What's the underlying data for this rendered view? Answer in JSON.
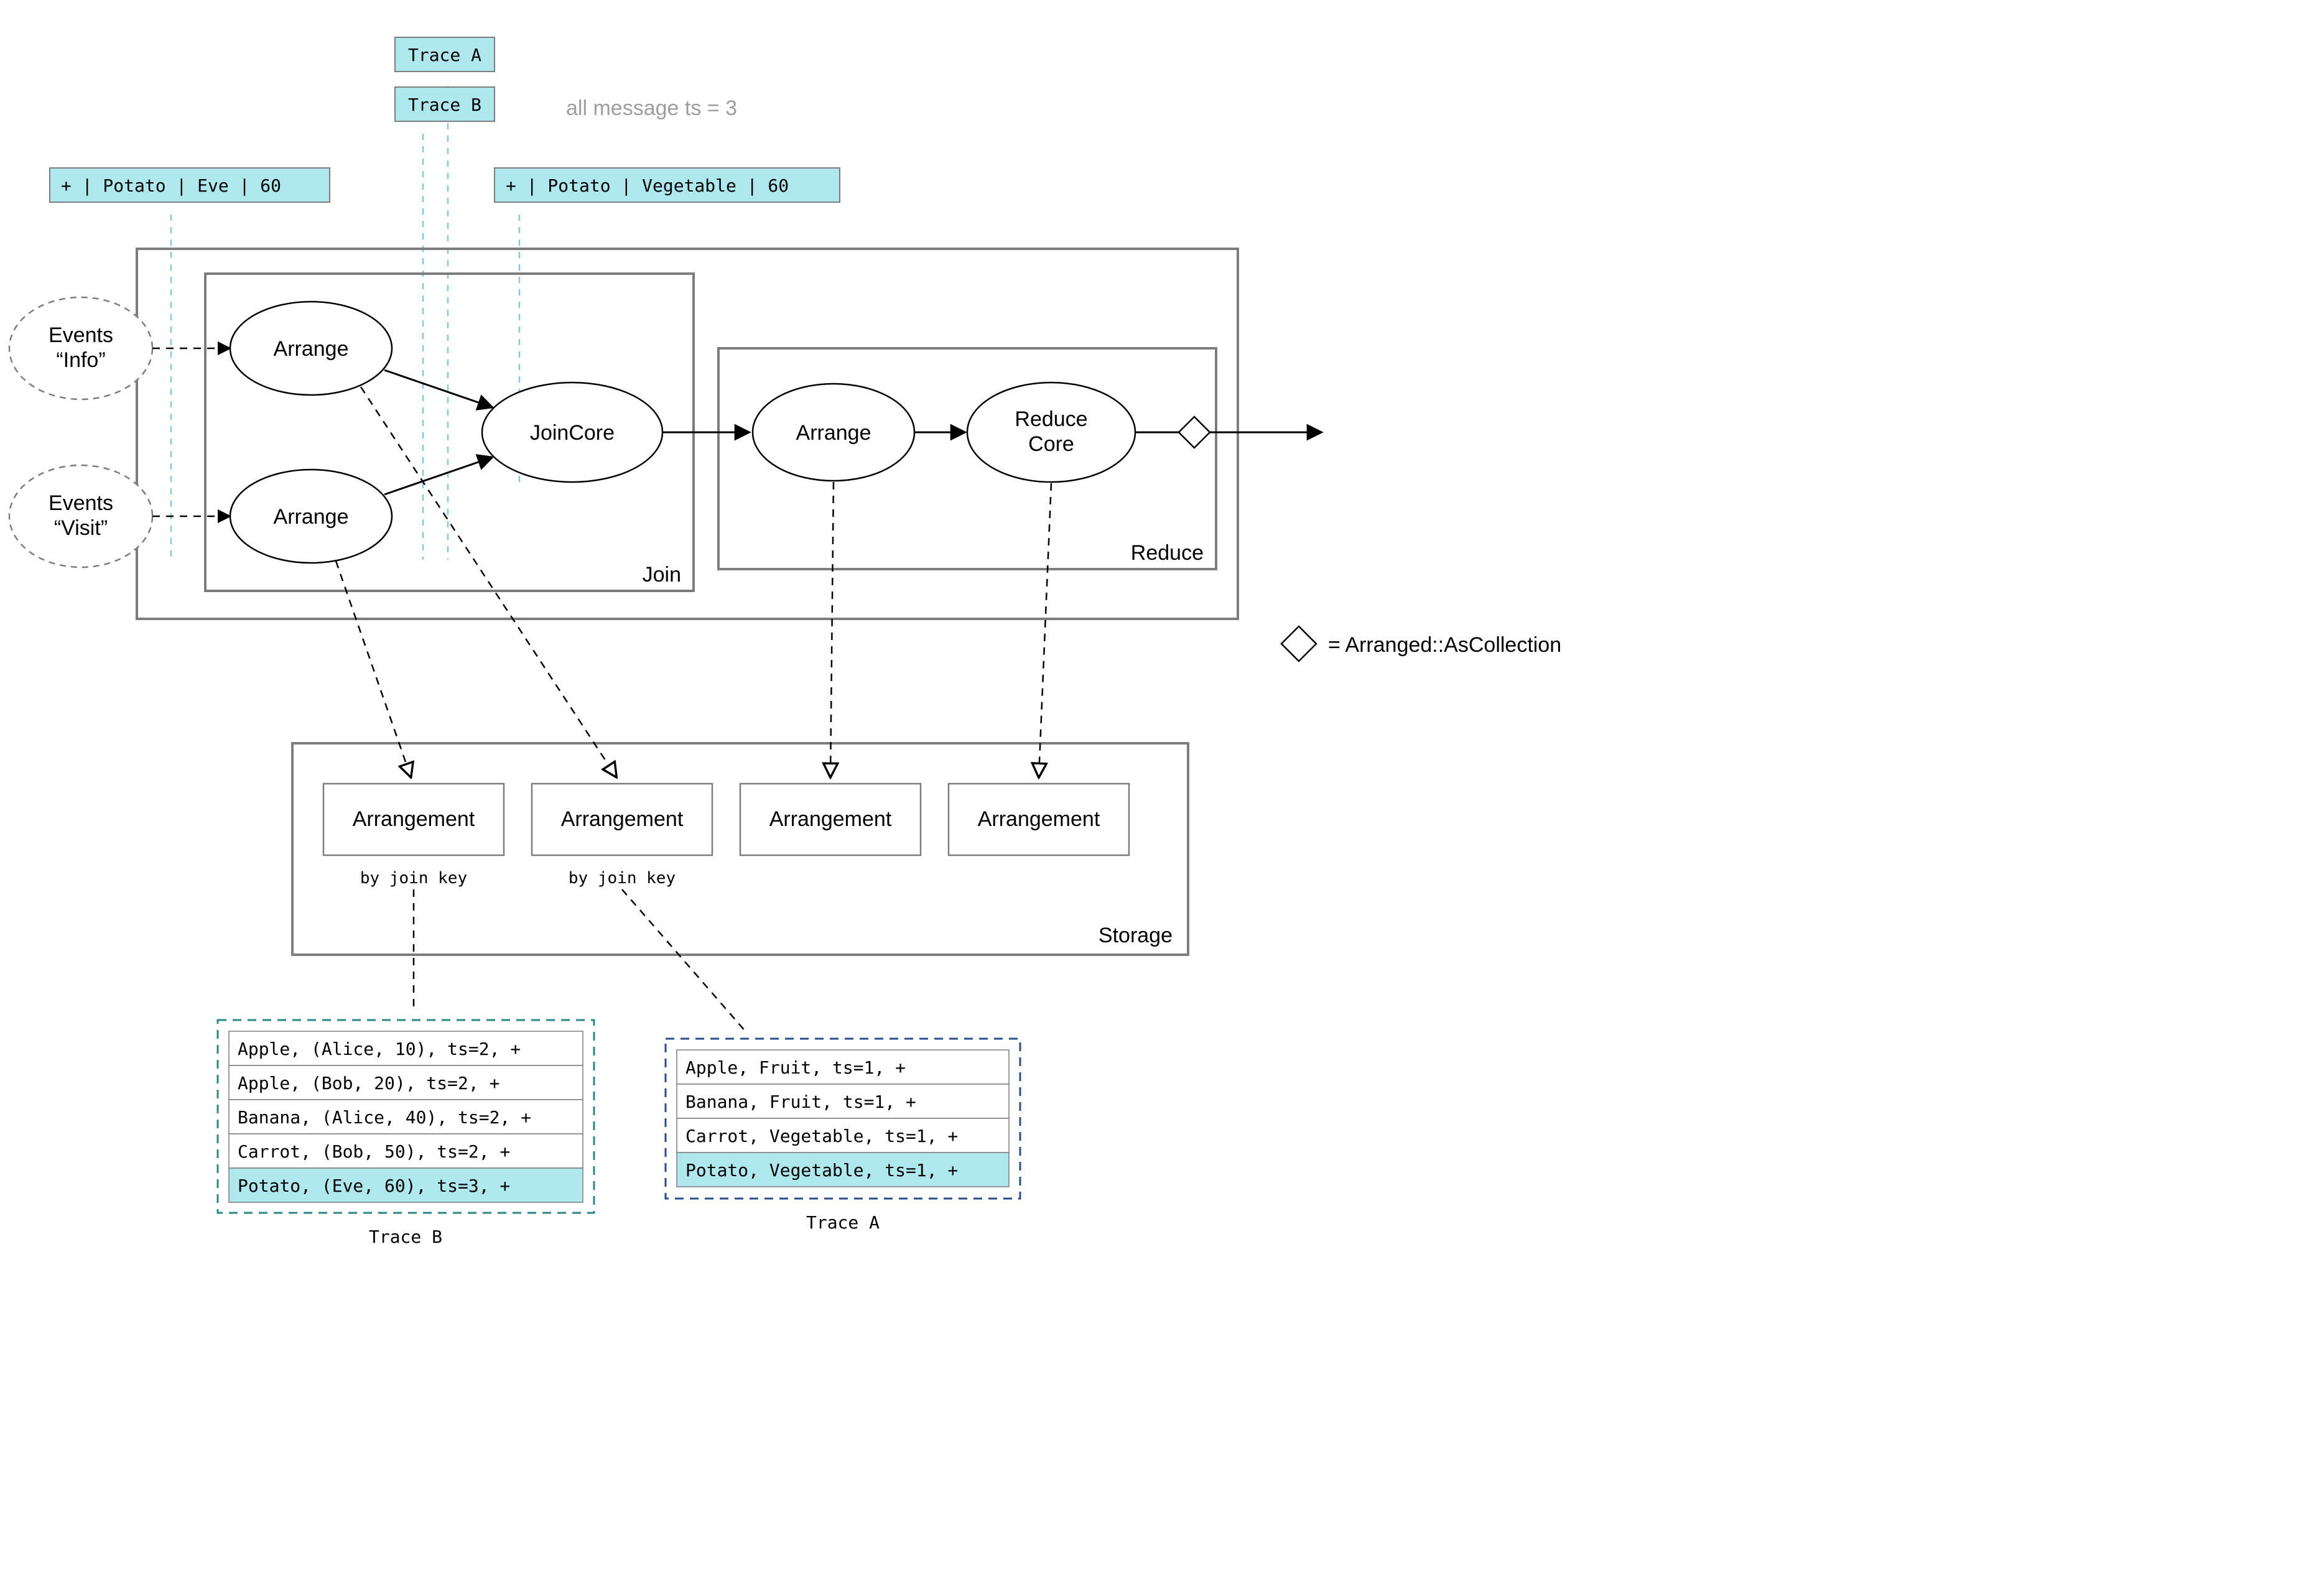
{
  "annotation": {
    "ts_note": "all message ts = 3"
  },
  "messages": {
    "trace_a_label": "Trace A",
    "trace_b_label": "Trace B",
    "left_msg": "+ | Potato | Eve | 60",
    "right_msg": "+ | Potato | Vegetable | 60"
  },
  "sources": {
    "info": "Events\n“Info”",
    "visit": "Events\n“Visit”"
  },
  "operators": {
    "arrange1": "Arrange",
    "arrange2": "Arrange",
    "joincore": "JoinCore",
    "arrange3": "Arrange",
    "reducecore": "Reduce\nCore",
    "join_box": "Join",
    "reduce_box": "Reduce"
  },
  "legend": {
    "diamond_label": "= Arranged::AsCollection"
  },
  "storage": {
    "box_label": "Storage",
    "slots": [
      "Arrangement",
      "Arrangement",
      "Arrangement",
      "Arrangement"
    ],
    "subcaptions": [
      "by join key",
      "by join key"
    ]
  },
  "traces": {
    "b": {
      "label": "Trace B",
      "rows": [
        {
          "text": "Apple, (Alice, 10), ts=2, +",
          "hl": false
        },
        {
          "text": "Apple, (Bob, 20), ts=2, +",
          "hl": false
        },
        {
          "text": "Banana, (Alice, 40), ts=2, +",
          "hl": false
        },
        {
          "text": "Carrot, (Bob, 50), ts=2, +",
          "hl": false
        },
        {
          "text": "Potato, (Eve, 60), ts=3, +",
          "hl": true
        }
      ]
    },
    "a": {
      "label": "Trace A",
      "rows": [
        {
          "text": "Apple, Fruit, ts=1, +",
          "hl": false
        },
        {
          "text": "Banana, Fruit, ts=1, +",
          "hl": false
        },
        {
          "text": "Carrot, Vegetable, ts=1, +",
          "hl": false
        },
        {
          "text": "Potato, Vegetable, ts=1, +",
          "hl": true
        }
      ]
    }
  }
}
